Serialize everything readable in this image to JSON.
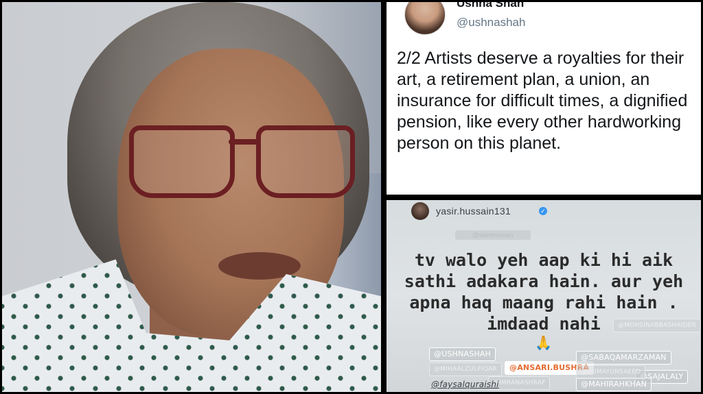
{
  "tweet": {
    "display_name": "Ushna Shah",
    "handle": "@ushnashah",
    "text": "2/2 Artists deserve a royalties for their art, a retirement plan, a union, an insurance for difficult times, a dignified pension, like every other hardworking person on this planet."
  },
  "story": {
    "username": "yasir.hussain131",
    "verified_glyph": "✓",
    "faint_tag": "@saimhussain",
    "message": "tv walo yeh aap ki hi aik sathi adakara hain. aur yeh apna haq maang rahi hain . imdaad nahi",
    "pray_emoji": "🙏",
    "tags": {
      "ushnashah": "@USHNASHAH",
      "mohsinabbas": "@MOHSINABBASHAIDER",
      "mihaal": "@MIHAALZULFIQAR",
      "ansari": "@ANSARI.BUSHRA",
      "sabaqamar": "@SABAQAMARZAMAN",
      "rehan": "@IMRANASHRAF",
      "sajal": "@SAJALALY",
      "faysal": "@faysalquraishi",
      "mahira": "@MAHIRAHKHAN",
      "humayun": "@HUMAYUNSAEED"
    }
  }
}
